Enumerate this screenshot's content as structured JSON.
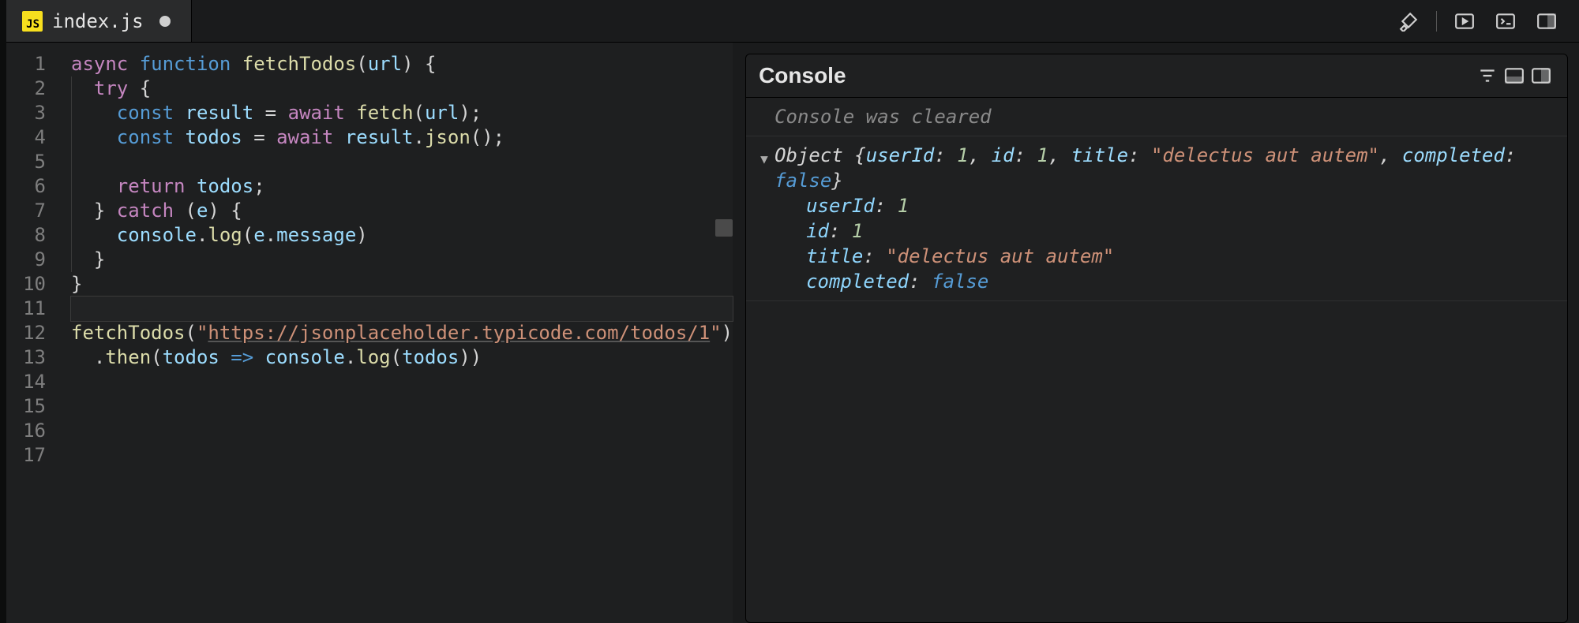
{
  "tab": {
    "icon_label": "JS",
    "filename": "index.js",
    "dirty": true
  },
  "toolbar_icons": {
    "brush": "brush-icon",
    "play": "play-icon",
    "terminal": "terminal-icon",
    "panel_right": "panel-right-icon"
  },
  "editor": {
    "line_count": 17,
    "code_lines": {
      "1": [
        {
          "t": "async ",
          "c": "kw"
        },
        {
          "t": "function ",
          "c": "kw2"
        },
        {
          "t": "fetchTodos",
          "c": "fn"
        },
        {
          "t": "(",
          "c": "punc"
        },
        {
          "t": "url",
          "c": "var"
        },
        {
          "t": ") {",
          "c": "punc"
        }
      ],
      "2": [
        {
          "t": "  ",
          "c": "punc"
        },
        {
          "t": "try",
          "c": "kw"
        },
        {
          "t": " {",
          "c": "punc"
        }
      ],
      "3": [
        {
          "t": "    ",
          "c": "punc"
        },
        {
          "t": "const ",
          "c": "kw2"
        },
        {
          "t": "result",
          "c": "var"
        },
        {
          "t": " = ",
          "c": "punc"
        },
        {
          "t": "await ",
          "c": "kw"
        },
        {
          "t": "fetch",
          "c": "fn"
        },
        {
          "t": "(",
          "c": "punc"
        },
        {
          "t": "url",
          "c": "var"
        },
        {
          "t": ");",
          "c": "punc"
        }
      ],
      "4": [
        {
          "t": "    ",
          "c": "punc"
        },
        {
          "t": "const ",
          "c": "kw2"
        },
        {
          "t": "todos",
          "c": "var"
        },
        {
          "t": " = ",
          "c": "punc"
        },
        {
          "t": "await ",
          "c": "kw"
        },
        {
          "t": "result",
          "c": "var"
        },
        {
          "t": ".",
          "c": "punc"
        },
        {
          "t": "json",
          "c": "fn"
        },
        {
          "t": "();",
          "c": "punc"
        }
      ],
      "5": [],
      "6": [
        {
          "t": "    ",
          "c": "punc"
        },
        {
          "t": "return ",
          "c": "kw"
        },
        {
          "t": "todos",
          "c": "var"
        },
        {
          "t": ";",
          "c": "punc"
        }
      ],
      "7": [
        {
          "t": "  } ",
          "c": "punc"
        },
        {
          "t": "catch",
          "c": "kw"
        },
        {
          "t": " (",
          "c": "punc"
        },
        {
          "t": "e",
          "c": "var"
        },
        {
          "t": ") {",
          "c": "punc"
        }
      ],
      "8": [
        {
          "t": "    ",
          "c": "punc"
        },
        {
          "t": "console",
          "c": "var"
        },
        {
          "t": ".",
          "c": "punc"
        },
        {
          "t": "log",
          "c": "fn"
        },
        {
          "t": "(",
          "c": "punc"
        },
        {
          "t": "e",
          "c": "var"
        },
        {
          "t": ".",
          "c": "punc"
        },
        {
          "t": "message",
          "c": "var"
        },
        {
          "t": ")",
          "c": "punc"
        }
      ],
      "9": [
        {
          "t": "  }",
          "c": "punc"
        }
      ],
      "10": [
        {
          "t": "}",
          "c": "punc"
        }
      ],
      "11": [],
      "12": [
        {
          "t": "fetchTodos",
          "c": "fn"
        },
        {
          "t": "(",
          "c": "punc"
        },
        {
          "t": "\"",
          "c": "str"
        },
        {
          "t": "https://jsonplaceholder.typicode.com/todos/1",
          "c": "url"
        },
        {
          "t": "\"",
          "c": "str"
        },
        {
          "t": ")",
          "c": "punc"
        }
      ],
      "13": [
        {
          "t": "  .",
          "c": "punc"
        },
        {
          "t": "then",
          "c": "fn"
        },
        {
          "t": "(",
          "c": "punc"
        },
        {
          "t": "todos",
          "c": "var"
        },
        {
          "t": " => ",
          "c": "kw2"
        },
        {
          "t": "console",
          "c": "var"
        },
        {
          "t": ".",
          "c": "punc"
        },
        {
          "t": "log",
          "c": "fn"
        },
        {
          "t": "(",
          "c": "punc"
        },
        {
          "t": "todos",
          "c": "var"
        },
        {
          "t": "))",
          "c": "punc"
        }
      ],
      "14": [],
      "15": [],
      "16": [],
      "17": []
    },
    "current_line": 11
  },
  "console": {
    "title": "Console",
    "cleared_msg": "Console was cleared",
    "object_label": "Object",
    "summary": {
      "userId": 1,
      "id": 1,
      "title": "delectus aut autem",
      "completed": false
    },
    "properties": [
      {
        "key": "userId",
        "value": 1,
        "type": "num"
      },
      {
        "key": "id",
        "value": 1,
        "type": "num"
      },
      {
        "key": "title",
        "value": "\"delectus aut autem\"",
        "type": "str"
      },
      {
        "key": "completed",
        "value": false,
        "type": "bool"
      }
    ]
  }
}
